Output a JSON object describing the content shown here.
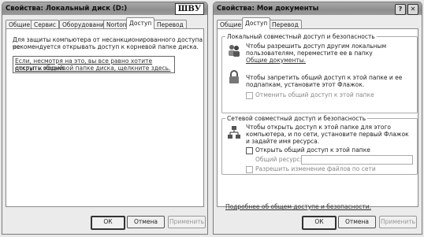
{
  "left_window": {
    "title": "Свойства: Локальный диск (D:)",
    "sticker": "ШВУ",
    "tabs": [
      "Общие",
      "Сервис",
      "Оборудование",
      "Norton",
      "Доступ",
      "Перевод"
    ],
    "active_tab": "Доступ",
    "intro_text_1": "Для защиты компьютера от несанкционированного доступа не",
    "intro_text_2": "рекомендуется открывать доступ к корневой папке диска.",
    "link_text_1": "Если, несмотря на это, вы все равно хотите открыть общий",
    "link_text_2": "доступ к корневой папке диска, щелкните здесь.",
    "buttons": {
      "ok": "ОК",
      "cancel": "Отмена",
      "apply": "Применить"
    }
  },
  "right_window": {
    "title": "Свойства: Мои документы",
    "help_button": "?",
    "close_button": "✕",
    "tabs": [
      "Общие",
      "Доступ",
      "Перевод"
    ],
    "active_tab": "Доступ",
    "local_group": {
      "legend": "Локальный совместный доступ и безопасность",
      "text_1": "Чтобы разрешить доступ другим локальным",
      "text_2": "пользователям, переместите ее в папку",
      "text_link": "Общие документы.",
      "private_1": "Чтобы запретить общий доступ к этой папке и ее",
      "private_2": "подпапкам, установите этот Флажок.",
      "checkbox_label": "Отменить общий доступ к этой папке"
    },
    "network_group": {
      "legend": "Сетевой совместный доступ и безопасность",
      "text_1": "Чтобы открыть доступ к этой папке для этого",
      "text_2": "компьютера, и по сети, установите первый Флажок",
      "text_3": "и задайте имя ресурса.",
      "share_checkbox": "Открыть общий доступ к этой папке",
      "share_name_label": "Общий ресурс:",
      "share_name_value": "",
      "allow_change_checkbox": "Разрешить изменение файлов по сети"
    },
    "more_info": "Подробнее об общем доступе и безопасности.",
    "buttons": {
      "ok": "ОК",
      "cancel": "Отмена",
      "apply": "Применить"
    }
  }
}
